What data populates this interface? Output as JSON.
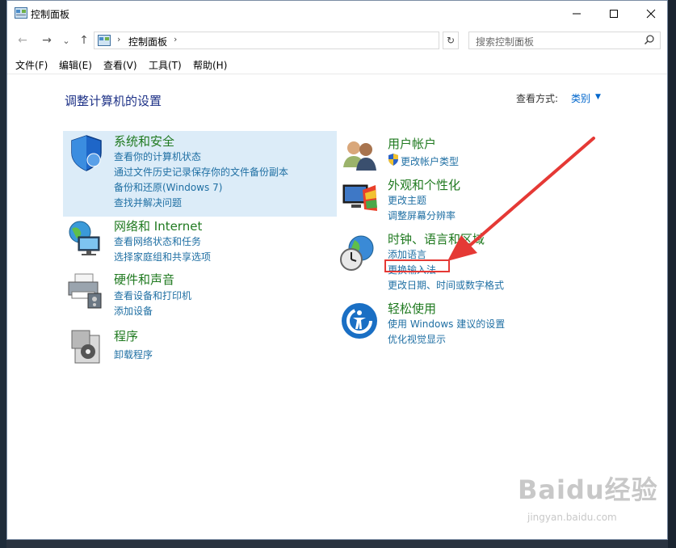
{
  "window": {
    "title": "控制面板"
  },
  "nav": {
    "back": "←",
    "forward": "→",
    "recent": "⌄",
    "up": "↑"
  },
  "address": {
    "path": "控制面板",
    "sep1": "›",
    "sep2": "›",
    "dropdown": "⌄",
    "refresh": "↻"
  },
  "search": {
    "placeholder": "搜索控制面板"
  },
  "menu": [
    "文件(F)",
    "编辑(E)",
    "查看(V)",
    "工具(T)",
    "帮助(H)"
  ],
  "heading": "调整计算机的设置",
  "view_by": {
    "label": "查看方式:",
    "value": "类别",
    "arrow": "▼"
  },
  "categories_left": [
    {
      "title": "系统和安全",
      "icon": "shield-icon",
      "links": [
        "查看你的计算机状态",
        "通过文件历史记录保存你的文件备份副本",
        "备份和还原(Windows 7)",
        "查找并解决问题"
      ]
    },
    {
      "title": "网络和 Internet",
      "icon": "network-globe-icon",
      "links": [
        "查看网络状态和任务",
        "选择家庭组和共享选项"
      ]
    },
    {
      "title": "硬件和声音",
      "icon": "printer-icon",
      "links": [
        "查看设备和打印机",
        "添加设备"
      ]
    },
    {
      "title": "程序",
      "icon": "programs-icon",
      "links": [
        "卸载程序"
      ]
    }
  ],
  "categories_right": [
    {
      "title": "用户帐户",
      "icon": "users-icon",
      "links": [
        "更改帐户类型"
      ]
    },
    {
      "title": "外观和个性化",
      "icon": "monitor-palette-icon",
      "links": [
        "更改主题",
        "调整屏幕分辨率"
      ]
    },
    {
      "title": "时钟、语言和区域",
      "icon": "clock-globe-icon",
      "links": [
        "添加语言",
        "更换输入法",
        "更改日期、时间或数字格式"
      ]
    },
    {
      "title": "轻松使用",
      "icon": "ease-of-access-icon",
      "links": [
        "使用 Windows 建议的设置",
        "优化视觉显示"
      ]
    }
  ],
  "watermark": {
    "brand": "Baidu经验",
    "url": "jingyan.baidu.com"
  },
  "colors": {
    "title_green": "#207a20",
    "link_blue": "#1f6fa3",
    "heading_blue": "#1e3287",
    "highlight": "#dcecf8",
    "annotation_red": "#e53935"
  }
}
